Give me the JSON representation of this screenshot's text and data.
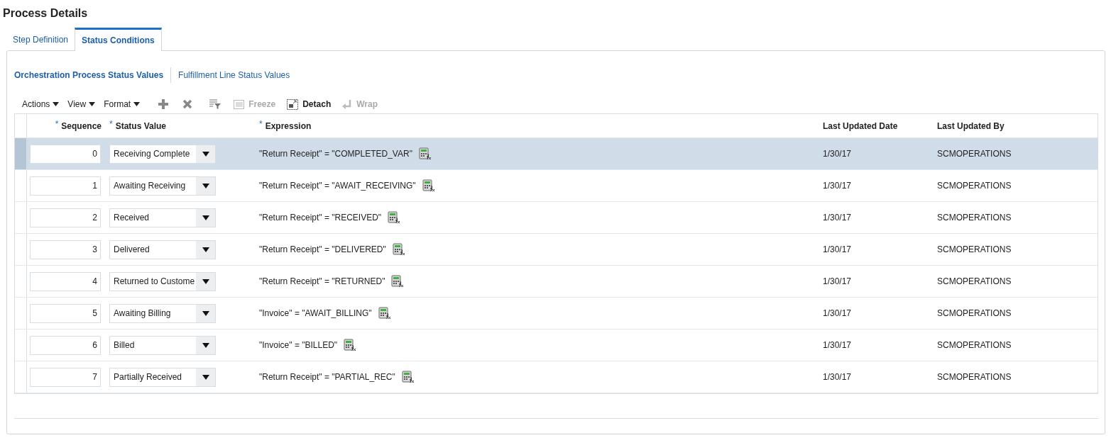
{
  "title": "Process Details",
  "tabs": [
    {
      "label": "Step Definition",
      "selected": false
    },
    {
      "label": "Status Conditions",
      "selected": true
    }
  ],
  "subtabs": [
    {
      "label": "Orchestration Process Status Values",
      "selected": true
    },
    {
      "label": "Fulfillment Line Status Values",
      "selected": false
    }
  ],
  "toolbar": [
    {
      "kind": "menu",
      "label": "Actions"
    },
    {
      "kind": "menu",
      "label": "View"
    },
    {
      "kind": "menu",
      "label": "Format"
    },
    {
      "kind": "add"
    },
    {
      "kind": "delete"
    },
    {
      "kind": "filter"
    },
    {
      "kind": "freeze",
      "label": "Freeze",
      "disabled": true
    },
    {
      "kind": "detach",
      "label": "Detach",
      "disabled": false
    },
    {
      "kind": "wrap",
      "label": "Wrap",
      "disabled": true
    }
  ],
  "table": {
    "columns": [
      {
        "label": "Sequence",
        "marker": "*"
      },
      {
        "label": "Status Value",
        "marker": "*"
      },
      {
        "label": "Expression",
        "marker": "*"
      },
      {
        "label": "Last Updated Date"
      },
      {
        "label": "Last Updated By"
      }
    ],
    "rows": [
      {
        "selected": true,
        "sequence": "0",
        "status": "Receiving Complete",
        "expression": "\"Return Receipt\" = \"COMPLETED_VAR\"",
        "date": "1/30/17",
        "by": "SCMOPERATIONS"
      },
      {
        "selected": false,
        "sequence": "1",
        "status": "Awaiting Receiving",
        "expression": "\"Return Receipt\" = \"AWAIT_RECEIVING\"",
        "date": "1/30/17",
        "by": "SCMOPERATIONS"
      },
      {
        "selected": false,
        "sequence": "2",
        "status": "Received",
        "expression": "\"Return Receipt\" = \"RECEIVED\"",
        "date": "1/30/17",
        "by": "SCMOPERATIONS"
      },
      {
        "selected": false,
        "sequence": "3",
        "status": "Delivered",
        "expression": "\"Return Receipt\" = \"DELIVERED\"",
        "date": "1/30/17",
        "by": "SCMOPERATIONS"
      },
      {
        "selected": false,
        "sequence": "4",
        "status": "Returned to Custome",
        "expression": "\"Return Receipt\" = \"RETURNED\"",
        "date": "1/30/17",
        "by": "SCMOPERATIONS"
      },
      {
        "selected": false,
        "sequence": "5",
        "status": "Awaiting Billing",
        "expression": "\"Invoice\" = \"AWAIT_BILLING\"",
        "date": "1/30/17",
        "by": "SCMOPERATIONS"
      },
      {
        "selected": false,
        "sequence": "6",
        "status": "Billed",
        "expression": "\"Invoice\" = \"BILLED\"",
        "date": "1/30/17",
        "by": "SCMOPERATIONS"
      },
      {
        "selected": false,
        "sequence": "7",
        "status": "Partially Received",
        "expression": "\"Return Receipt\" = \"PARTIAL_REC\"",
        "date": "1/30/17",
        "by": "SCMOPERATIONS"
      }
    ]
  }
}
